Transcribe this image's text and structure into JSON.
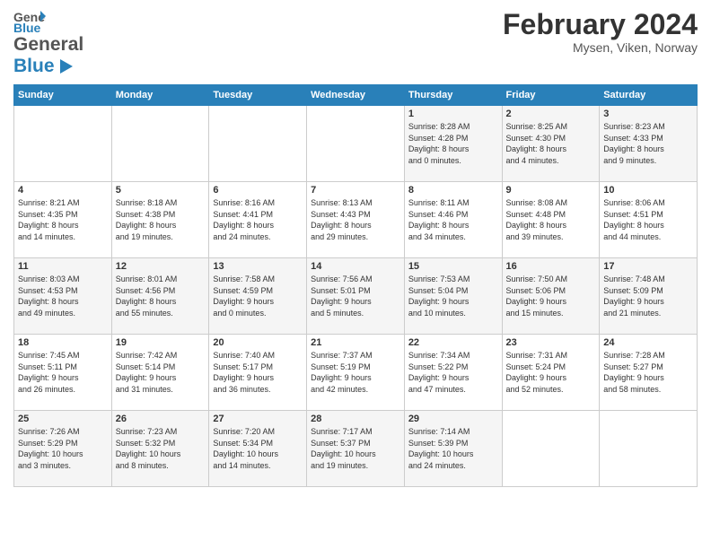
{
  "header": {
    "logo_general": "General",
    "logo_blue": "Blue",
    "month_title": "February 2024",
    "location": "Mysen, Viken, Norway"
  },
  "days_of_week": [
    "Sunday",
    "Monday",
    "Tuesday",
    "Wednesday",
    "Thursday",
    "Friday",
    "Saturday"
  ],
  "weeks": [
    [
      {
        "day": "",
        "info": ""
      },
      {
        "day": "",
        "info": ""
      },
      {
        "day": "",
        "info": ""
      },
      {
        "day": "",
        "info": ""
      },
      {
        "day": "1",
        "info": "Sunrise: 8:28 AM\nSunset: 4:28 PM\nDaylight: 8 hours\nand 0 minutes."
      },
      {
        "day": "2",
        "info": "Sunrise: 8:25 AM\nSunset: 4:30 PM\nDaylight: 8 hours\nand 4 minutes."
      },
      {
        "day": "3",
        "info": "Sunrise: 8:23 AM\nSunset: 4:33 PM\nDaylight: 8 hours\nand 9 minutes."
      }
    ],
    [
      {
        "day": "4",
        "info": "Sunrise: 8:21 AM\nSunset: 4:35 PM\nDaylight: 8 hours\nand 14 minutes."
      },
      {
        "day": "5",
        "info": "Sunrise: 8:18 AM\nSunset: 4:38 PM\nDaylight: 8 hours\nand 19 minutes."
      },
      {
        "day": "6",
        "info": "Sunrise: 8:16 AM\nSunset: 4:41 PM\nDaylight: 8 hours\nand 24 minutes."
      },
      {
        "day": "7",
        "info": "Sunrise: 8:13 AM\nSunset: 4:43 PM\nDaylight: 8 hours\nand 29 minutes."
      },
      {
        "day": "8",
        "info": "Sunrise: 8:11 AM\nSunset: 4:46 PM\nDaylight: 8 hours\nand 34 minutes."
      },
      {
        "day": "9",
        "info": "Sunrise: 8:08 AM\nSunset: 4:48 PM\nDaylight: 8 hours\nand 39 minutes."
      },
      {
        "day": "10",
        "info": "Sunrise: 8:06 AM\nSunset: 4:51 PM\nDaylight: 8 hours\nand 44 minutes."
      }
    ],
    [
      {
        "day": "11",
        "info": "Sunrise: 8:03 AM\nSunset: 4:53 PM\nDaylight: 8 hours\nand 49 minutes."
      },
      {
        "day": "12",
        "info": "Sunrise: 8:01 AM\nSunset: 4:56 PM\nDaylight: 8 hours\nand 55 minutes."
      },
      {
        "day": "13",
        "info": "Sunrise: 7:58 AM\nSunset: 4:59 PM\nDaylight: 9 hours\nand 0 minutes."
      },
      {
        "day": "14",
        "info": "Sunrise: 7:56 AM\nSunset: 5:01 PM\nDaylight: 9 hours\nand 5 minutes."
      },
      {
        "day": "15",
        "info": "Sunrise: 7:53 AM\nSunset: 5:04 PM\nDaylight: 9 hours\nand 10 minutes."
      },
      {
        "day": "16",
        "info": "Sunrise: 7:50 AM\nSunset: 5:06 PM\nDaylight: 9 hours\nand 15 minutes."
      },
      {
        "day": "17",
        "info": "Sunrise: 7:48 AM\nSunset: 5:09 PM\nDaylight: 9 hours\nand 21 minutes."
      }
    ],
    [
      {
        "day": "18",
        "info": "Sunrise: 7:45 AM\nSunset: 5:11 PM\nDaylight: 9 hours\nand 26 minutes."
      },
      {
        "day": "19",
        "info": "Sunrise: 7:42 AM\nSunset: 5:14 PM\nDaylight: 9 hours\nand 31 minutes."
      },
      {
        "day": "20",
        "info": "Sunrise: 7:40 AM\nSunset: 5:17 PM\nDaylight: 9 hours\nand 36 minutes."
      },
      {
        "day": "21",
        "info": "Sunrise: 7:37 AM\nSunset: 5:19 PM\nDaylight: 9 hours\nand 42 minutes."
      },
      {
        "day": "22",
        "info": "Sunrise: 7:34 AM\nSunset: 5:22 PM\nDaylight: 9 hours\nand 47 minutes."
      },
      {
        "day": "23",
        "info": "Sunrise: 7:31 AM\nSunset: 5:24 PM\nDaylight: 9 hours\nand 52 minutes."
      },
      {
        "day": "24",
        "info": "Sunrise: 7:28 AM\nSunset: 5:27 PM\nDaylight: 9 hours\nand 58 minutes."
      }
    ],
    [
      {
        "day": "25",
        "info": "Sunrise: 7:26 AM\nSunset: 5:29 PM\nDaylight: 10 hours\nand 3 minutes."
      },
      {
        "day": "26",
        "info": "Sunrise: 7:23 AM\nSunset: 5:32 PM\nDaylight: 10 hours\nand 8 minutes."
      },
      {
        "day": "27",
        "info": "Sunrise: 7:20 AM\nSunset: 5:34 PM\nDaylight: 10 hours\nand 14 minutes."
      },
      {
        "day": "28",
        "info": "Sunrise: 7:17 AM\nSunset: 5:37 PM\nDaylight: 10 hours\nand 19 minutes."
      },
      {
        "day": "29",
        "info": "Sunrise: 7:14 AM\nSunset: 5:39 PM\nDaylight: 10 hours\nand 24 minutes."
      },
      {
        "day": "",
        "info": ""
      },
      {
        "day": "",
        "info": ""
      }
    ]
  ]
}
